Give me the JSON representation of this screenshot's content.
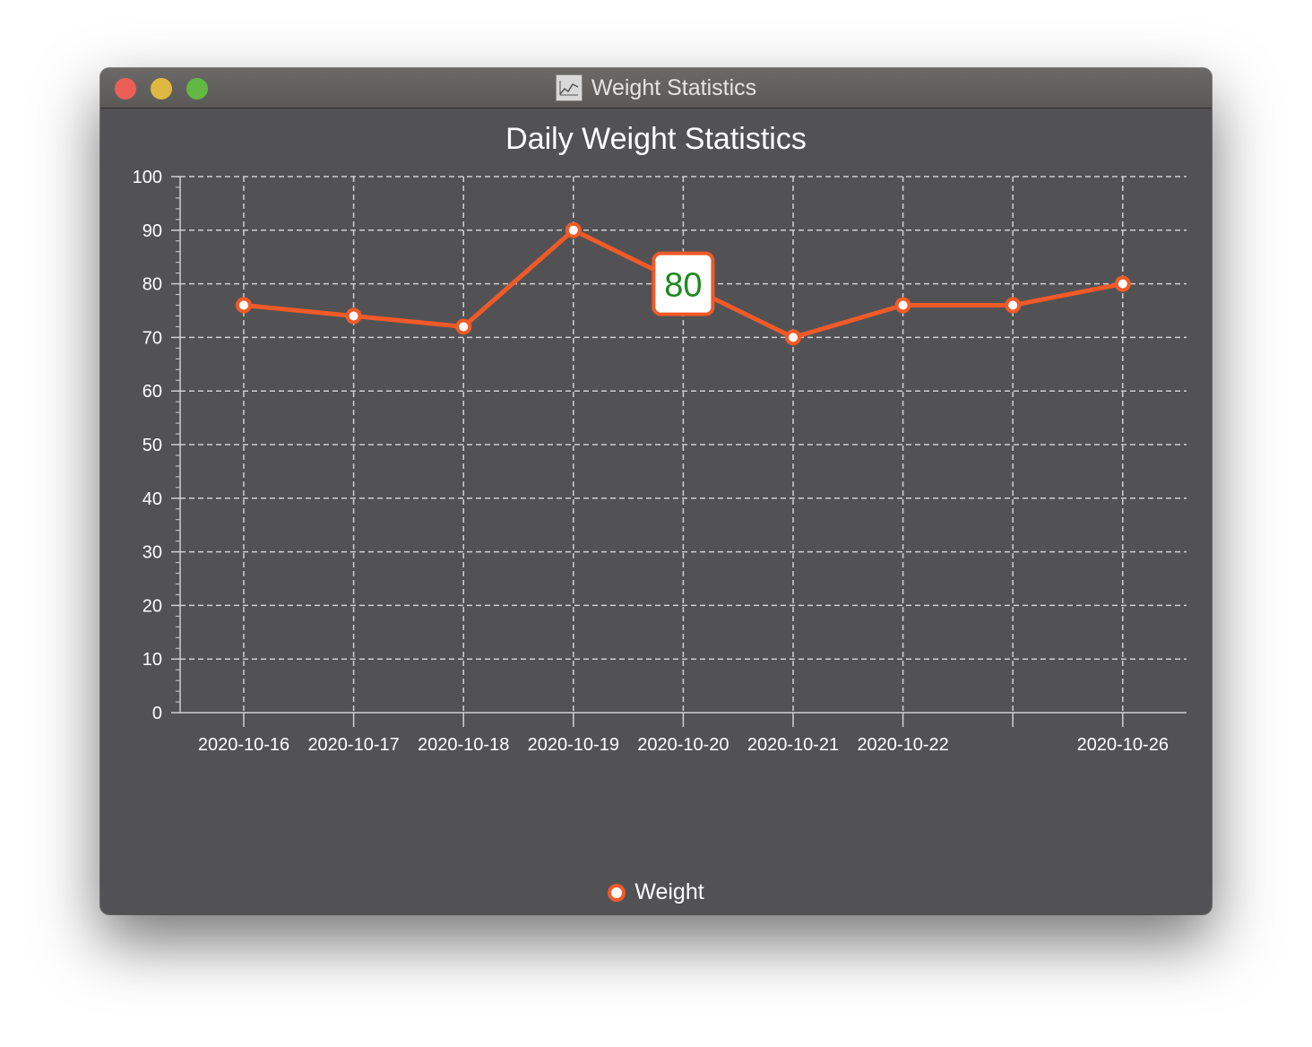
{
  "window": {
    "title": "Weight Statistics",
    "app_icon": "line-chart-icon"
  },
  "colors": {
    "background": "#525254",
    "series": "#f05a28",
    "grid": "#d0d0d0",
    "text": "#ffffff",
    "tooltip_text": "#1e8a1e"
  },
  "tooltip": {
    "value": "80",
    "x_category": "2020-10-20"
  },
  "chart_data": {
    "type": "line",
    "title": "Daily Weight Statistics",
    "xlabel": "",
    "ylabel": "",
    "ylim": [
      0,
      100
    ],
    "y_ticks": [
      0,
      10,
      20,
      30,
      40,
      50,
      60,
      70,
      80,
      90,
      100
    ],
    "y_minor_step": 2,
    "categories": [
      "2020-10-16",
      "2020-10-17",
      "2020-10-18",
      "2020-10-19",
      "2020-10-20",
      "2020-10-21",
      "2020-10-22",
      "",
      "2020-10-26"
    ],
    "series": [
      {
        "name": "Weight",
        "values": [
          76,
          74,
          72,
          90,
          80,
          70,
          76,
          76,
          80
        ]
      }
    ],
    "grid": true,
    "grid_style": "dashed",
    "legend": "bottom-center"
  }
}
